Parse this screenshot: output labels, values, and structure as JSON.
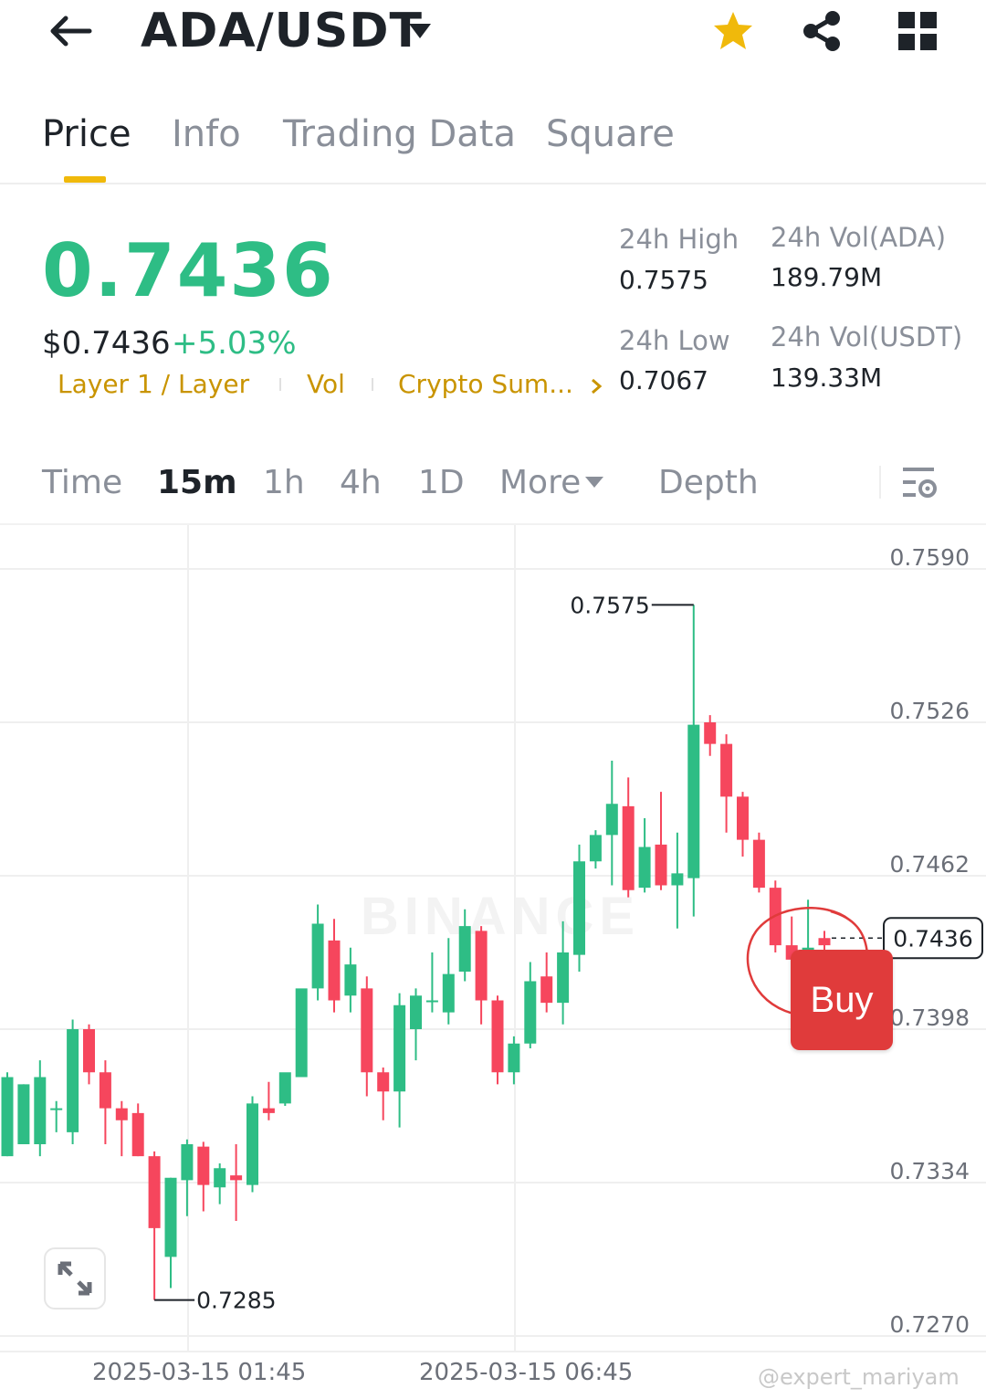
{
  "header": {
    "back_icon": "arrow-left-icon",
    "pair": "ADA/USDT",
    "dropdown_icon": "caret-down-icon",
    "favorite_icon": "star-icon",
    "share_icon": "share-icon",
    "menu_icon": "grid-icon",
    "star_color": "#f0b90b"
  },
  "tabs": [
    {
      "label": "Price",
      "active": true
    },
    {
      "label": "Info",
      "active": false
    },
    {
      "label": "Trading Data",
      "active": false
    },
    {
      "label": "Square",
      "active": false
    }
  ],
  "ticker": {
    "last_price": "0.7436",
    "usd_price": "$0.7436",
    "change_pct": "+5.03%",
    "tags": [
      "Layer 1 / Layer",
      "Vol",
      "Crypto Sum..."
    ],
    "stats": {
      "high_label": "24h High",
      "high": "0.7575",
      "low_label": "24h Low",
      "low": "0.7067",
      "vol_base_label": "24h Vol(ADA)",
      "vol_base": "189.79M",
      "vol_quote_label": "24h Vol(USDT)",
      "vol_quote": "139.33M"
    },
    "up_color": "#2ebd85",
    "down_color": "#f6465d"
  },
  "intervals": {
    "items": [
      "Time",
      "15m",
      "1h",
      "4h",
      "1D",
      "More",
      "Depth"
    ],
    "active": "15m",
    "settings_icon": "chart-settings-icon"
  },
  "chart_data": {
    "type": "candlestick",
    "interval": "15m",
    "ylim": [
      0.7255,
      0.762
    ],
    "yticks": [
      "0.7590",
      "0.7526",
      "0.7462",
      "0.7398",
      "0.7334",
      "0.7270"
    ],
    "xticks": [
      "2025-03-15 01:45",
      "2025-03-15 06:45"
    ],
    "high_marker": "0.7575",
    "low_marker": "0.7285",
    "current_price_label": "0.7436",
    "watermark": "BINANCE",
    "candles": [
      {
        "o": 0.7345,
        "h": 0.738,
        "l": 0.7345,
        "c": 0.7378
      },
      {
        "o": 0.735,
        "h": 0.7375,
        "l": 0.735,
        "c": 0.7375
      },
      {
        "o": 0.735,
        "h": 0.7385,
        "l": 0.7345,
        "c": 0.7378
      },
      {
        "o": 0.7365,
        "h": 0.7368,
        "l": 0.7355,
        "c": 0.7365
      },
      {
        "o": 0.7355,
        "h": 0.7402,
        "l": 0.735,
        "c": 0.7398
      },
      {
        "o": 0.7398,
        "h": 0.74,
        "l": 0.7375,
        "c": 0.738
      },
      {
        "o": 0.738,
        "h": 0.7385,
        "l": 0.735,
        "c": 0.7365
      },
      {
        "o": 0.7365,
        "h": 0.7368,
        "l": 0.7345,
        "c": 0.736
      },
      {
        "o": 0.7363,
        "h": 0.7367,
        "l": 0.7345,
        "c": 0.7345
      },
      {
        "o": 0.7345,
        "h": 0.7347,
        "l": 0.7285,
        "c": 0.7315
      },
      {
        "o": 0.7303,
        "h": 0.7336,
        "l": 0.729,
        "c": 0.7336
      },
      {
        "o": 0.7335,
        "h": 0.7352,
        "l": 0.732,
        "c": 0.735
      },
      {
        "o": 0.7349,
        "h": 0.7351,
        "l": 0.7322,
        "c": 0.7333
      },
      {
        "o": 0.7332,
        "h": 0.7342,
        "l": 0.7325,
        "c": 0.734
      },
      {
        "o": 0.7337,
        "h": 0.735,
        "l": 0.7318,
        "c": 0.7335
      },
      {
        "o": 0.7333,
        "h": 0.737,
        "l": 0.733,
        "c": 0.7367
      },
      {
        "o": 0.7365,
        "h": 0.7376,
        "l": 0.736,
        "c": 0.7363
      },
      {
        "o": 0.7367,
        "h": 0.7379,
        "l": 0.7366,
        "c": 0.738
      },
      {
        "o": 0.7378,
        "h": 0.7413,
        "l": 0.7378,
        "c": 0.7415
      },
      {
        "o": 0.7415,
        "h": 0.745,
        "l": 0.741,
        "c": 0.7442
      },
      {
        "o": 0.7435,
        "h": 0.7444,
        "l": 0.7405,
        "c": 0.741
      },
      {
        "o": 0.7412,
        "h": 0.7432,
        "l": 0.7405,
        "c": 0.7425
      },
      {
        "o": 0.7415,
        "h": 0.742,
        "l": 0.737,
        "c": 0.738
      },
      {
        "o": 0.738,
        "h": 0.7382,
        "l": 0.736,
        "c": 0.7372
      },
      {
        "o": 0.7372,
        "h": 0.7413,
        "l": 0.7357,
        "c": 0.7408
      },
      {
        "o": 0.7398,
        "h": 0.7415,
        "l": 0.7385,
        "c": 0.7412
      },
      {
        "o": 0.741,
        "h": 0.743,
        "l": 0.7405,
        "c": 0.741
      },
      {
        "o": 0.7405,
        "h": 0.7436,
        "l": 0.74,
        "c": 0.7421
      },
      {
        "o": 0.7422,
        "h": 0.7448,
        "l": 0.7418,
        "c": 0.7441
      },
      {
        "o": 0.7439,
        "h": 0.7441,
        "l": 0.74,
        "c": 0.741
      },
      {
        "o": 0.741,
        "h": 0.7412,
        "l": 0.7375,
        "c": 0.738
      },
      {
        "o": 0.738,
        "h": 0.7395,
        "l": 0.7375,
        "c": 0.7392
      },
      {
        "o": 0.7392,
        "h": 0.7426,
        "l": 0.739,
        "c": 0.7418
      },
      {
        "o": 0.742,
        "h": 0.743,
        "l": 0.7405,
        "c": 0.7409
      },
      {
        "o": 0.7409,
        "h": 0.7443,
        "l": 0.74,
        "c": 0.743
      },
      {
        "o": 0.7429,
        "h": 0.7475,
        "l": 0.7422,
        "c": 0.7468
      },
      {
        "o": 0.7468,
        "h": 0.7481,
        "l": 0.7465,
        "c": 0.7479
      },
      {
        "o": 0.7479,
        "h": 0.751,
        "l": 0.7458,
        "c": 0.7492
      },
      {
        "o": 0.7491,
        "h": 0.7503,
        "l": 0.7453,
        "c": 0.7456
      },
      {
        "o": 0.7457,
        "h": 0.7486,
        "l": 0.7455,
        "c": 0.7474
      },
      {
        "o": 0.7475,
        "h": 0.7497,
        "l": 0.7456,
        "c": 0.7458
      },
      {
        "o": 0.7458,
        "h": 0.748,
        "l": 0.744,
        "c": 0.7463
      },
      {
        "o": 0.7461,
        "h": 0.7575,
        "l": 0.7445,
        "c": 0.7525
      },
      {
        "o": 0.7526,
        "h": 0.7529,
        "l": 0.7512,
        "c": 0.7517
      },
      {
        "o": 0.7517,
        "h": 0.7521,
        "l": 0.748,
        "c": 0.7495
      },
      {
        "o": 0.7495,
        "h": 0.7497,
        "l": 0.747,
        "c": 0.7477
      },
      {
        "o": 0.7477,
        "h": 0.748,
        "l": 0.7455,
        "c": 0.7457
      },
      {
        "o": 0.7457,
        "h": 0.746,
        "l": 0.743,
        "c": 0.7433
      },
      {
        "o": 0.7433,
        "h": 0.7445,
        "l": 0.7422,
        "c": 0.7427
      },
      {
        "o": 0.7427,
        "h": 0.7452,
        "l": 0.7424,
        "c": 0.7432
      },
      {
        "o": 0.7436,
        "h": 0.7439,
        "l": 0.743,
        "c": 0.7433
      }
    ]
  },
  "buy_button": {
    "label": "Buy",
    "color": "#e03b3b"
  },
  "expand_icon": "expand-icon",
  "watermark_text": "@expert_mariyam"
}
